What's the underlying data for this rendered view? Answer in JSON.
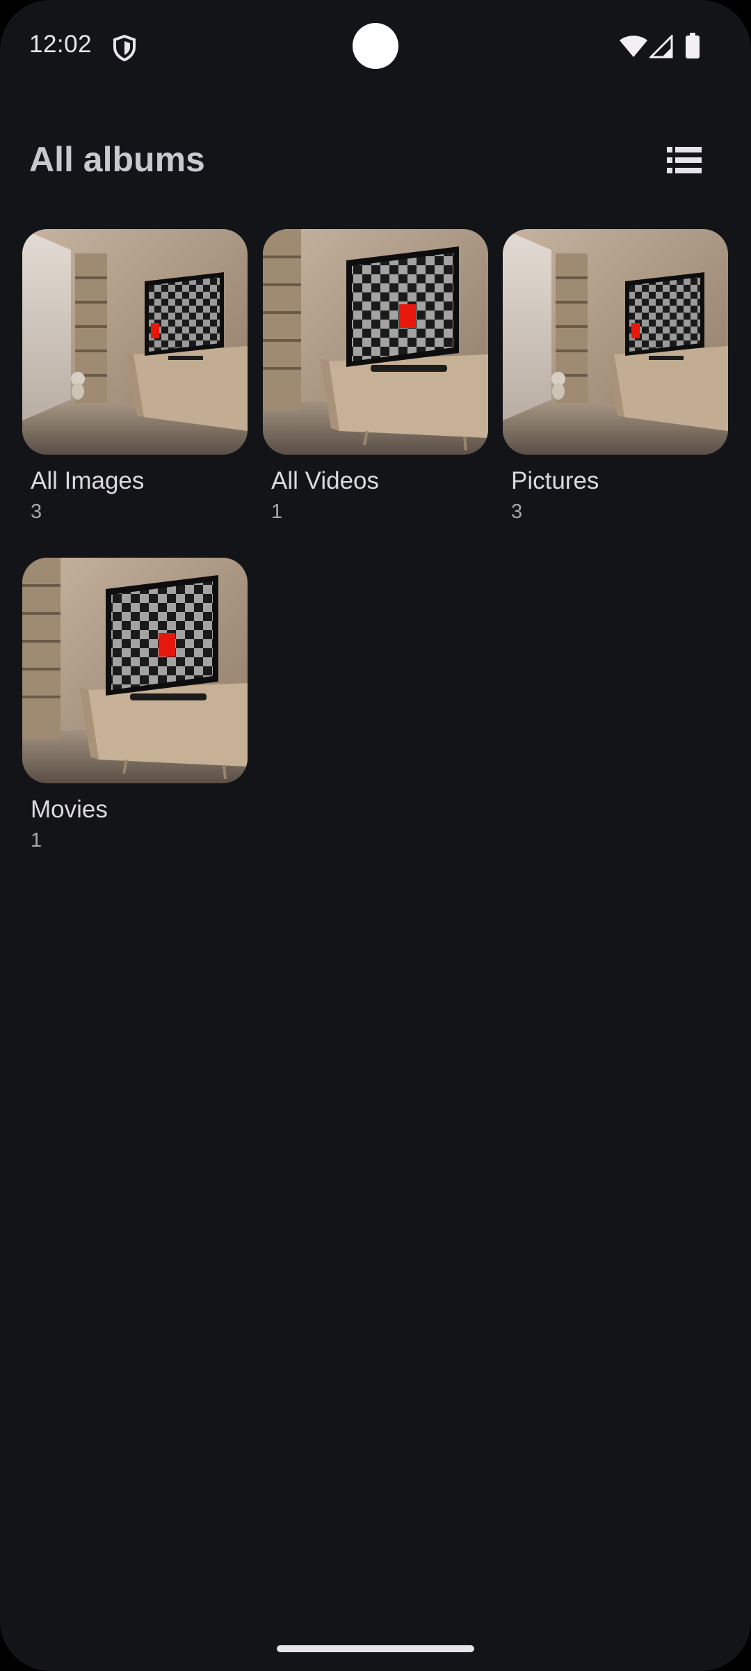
{
  "status_bar": {
    "time": "12:02",
    "icons": [
      "shield-icon",
      "wifi-icon",
      "signal-icon",
      "battery-icon"
    ]
  },
  "header": {
    "title": "All albums",
    "view_toggle_icon": "list-view-icon"
  },
  "albums": [
    {
      "name": "All Images",
      "count": "3",
      "thumbnail": "tv-room-wide"
    },
    {
      "name": "All Videos",
      "count": "1",
      "thumbnail": "tv-room-close"
    },
    {
      "name": "Pictures",
      "count": "3",
      "thumbnail": "tv-room-wide"
    },
    {
      "name": "Movies",
      "count": "1",
      "thumbnail": "tv-room-close"
    }
  ],
  "colors": {
    "background": "#131418",
    "text_primary": "#dcdae0",
    "text_secondary": "#a9a8ae",
    "accent_red": "#e8170c"
  }
}
